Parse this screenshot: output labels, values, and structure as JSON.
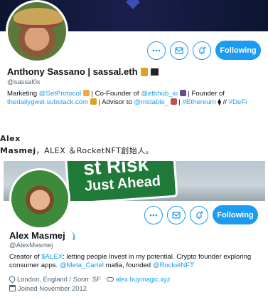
{
  "profile1": {
    "name": "Anthony Sassano | sassal.eth",
    "handle": "@sassal0x",
    "bio": {
      "t1": "Marketing ",
      "l1": "@SetProtocol",
      "t2": " | Co-Founder of ",
      "l2": "@ethhub_io",
      "t3": " | Founder of ",
      "l3": "thedailygwei.substack.com",
      "t4": " | Advisor to ",
      "l4": "@mstable_",
      "t5": " | ",
      "l5": "#Ethereum",
      "t6": " ⧫ //",
      "l6": "#DeFi"
    },
    "follow_label": "Following",
    "icons": [
      "more-icon",
      "message-icon",
      "notification-add-icon"
    ]
  },
  "caption": {
    "line1": "Alex",
    "line2_name": "Masmej",
    "line2_rest": "，ALEX ＆RocketNFT創始人。"
  },
  "profile2": {
    "banner_text": [
      "st Risk",
      "Just Ahead"
    ],
    "name": "Alex Masmej",
    "handle": "@AlexMasmej",
    "bio": {
      "t1": "Creator of ",
      "l1": "$ALEX",
      "t2": ": letting people invest in my potential. Crypto founder exploring consumer apps. ",
      "l2": "@Meta_Cartel",
      "t3": " mafia, founded ",
      "l3": "@RocketNFT"
    },
    "location": "London, England / Soon: SF",
    "website": "alex.buymagic.xyz",
    "joined": "Joined November 2012",
    "follow_label": "Following"
  },
  "colors": {
    "accent": "#1d9bf0",
    "text": "#0f1419",
    "muted": "#536471"
  }
}
